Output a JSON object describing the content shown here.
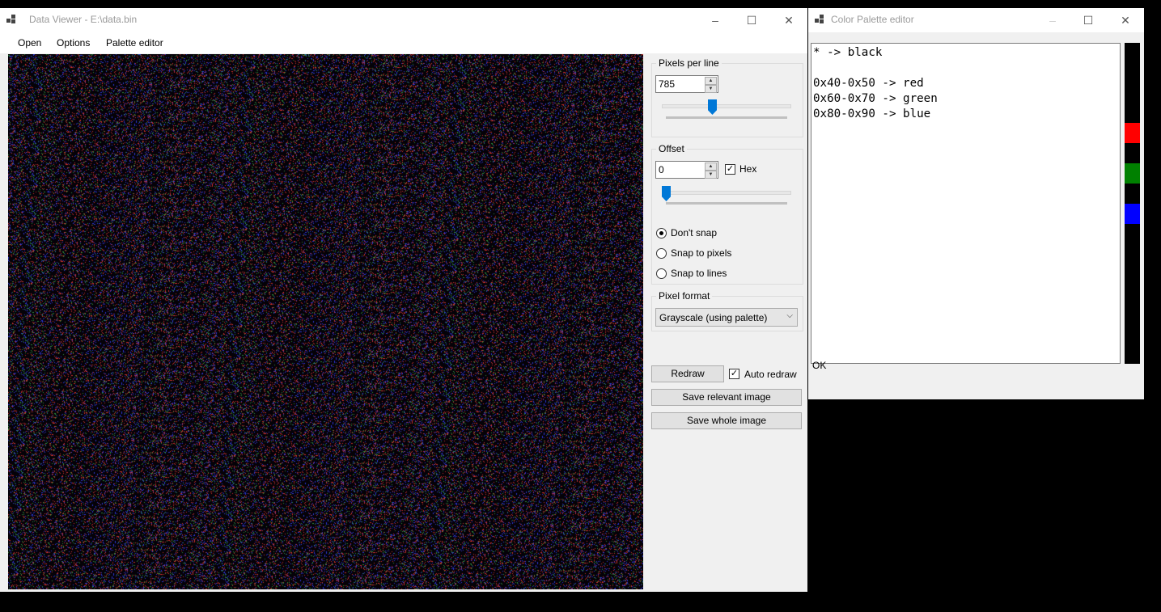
{
  "main_window": {
    "title": "Data Viewer - E:\\data.bin",
    "menu": [
      "Open",
      "Options",
      "Palette editor"
    ],
    "pixels_per_line": {
      "label": "Pixels per line",
      "value": "785"
    },
    "offset": {
      "label": "Offset",
      "value": "0",
      "hex_label": "Hex",
      "hex_checked": true
    },
    "snap": {
      "options": [
        "Don't snap",
        "Snap to pixels",
        "Snap to lines"
      ],
      "selected": 0
    },
    "pixel_format": {
      "label": "Pixel format",
      "value": "Grayscale (using palette)"
    },
    "redraw_label": "Redraw",
    "auto_redraw_label": "Auto redraw",
    "auto_redraw_checked": true,
    "save_relevant_label": "Save relevant image",
    "save_whole_label": "Save whole image"
  },
  "palette_window": {
    "title": "Color Palette editor",
    "text": "* -> black\n\n0x40-0x50 -> red\n0x60-0x70 -> green\n0x80-0x90 -> blue",
    "status": "OK",
    "swatches": [
      "#ff0000",
      "#008000",
      "#0000ff"
    ]
  },
  "icons": {
    "minimize": "minimize-icon",
    "maximize": "maximize-icon",
    "close": "close-icon",
    "app": "app-icon"
  },
  "colors": {
    "noise": [
      "#c0392b",
      "#2e8b3a",
      "#2a3bd6"
    ]
  }
}
